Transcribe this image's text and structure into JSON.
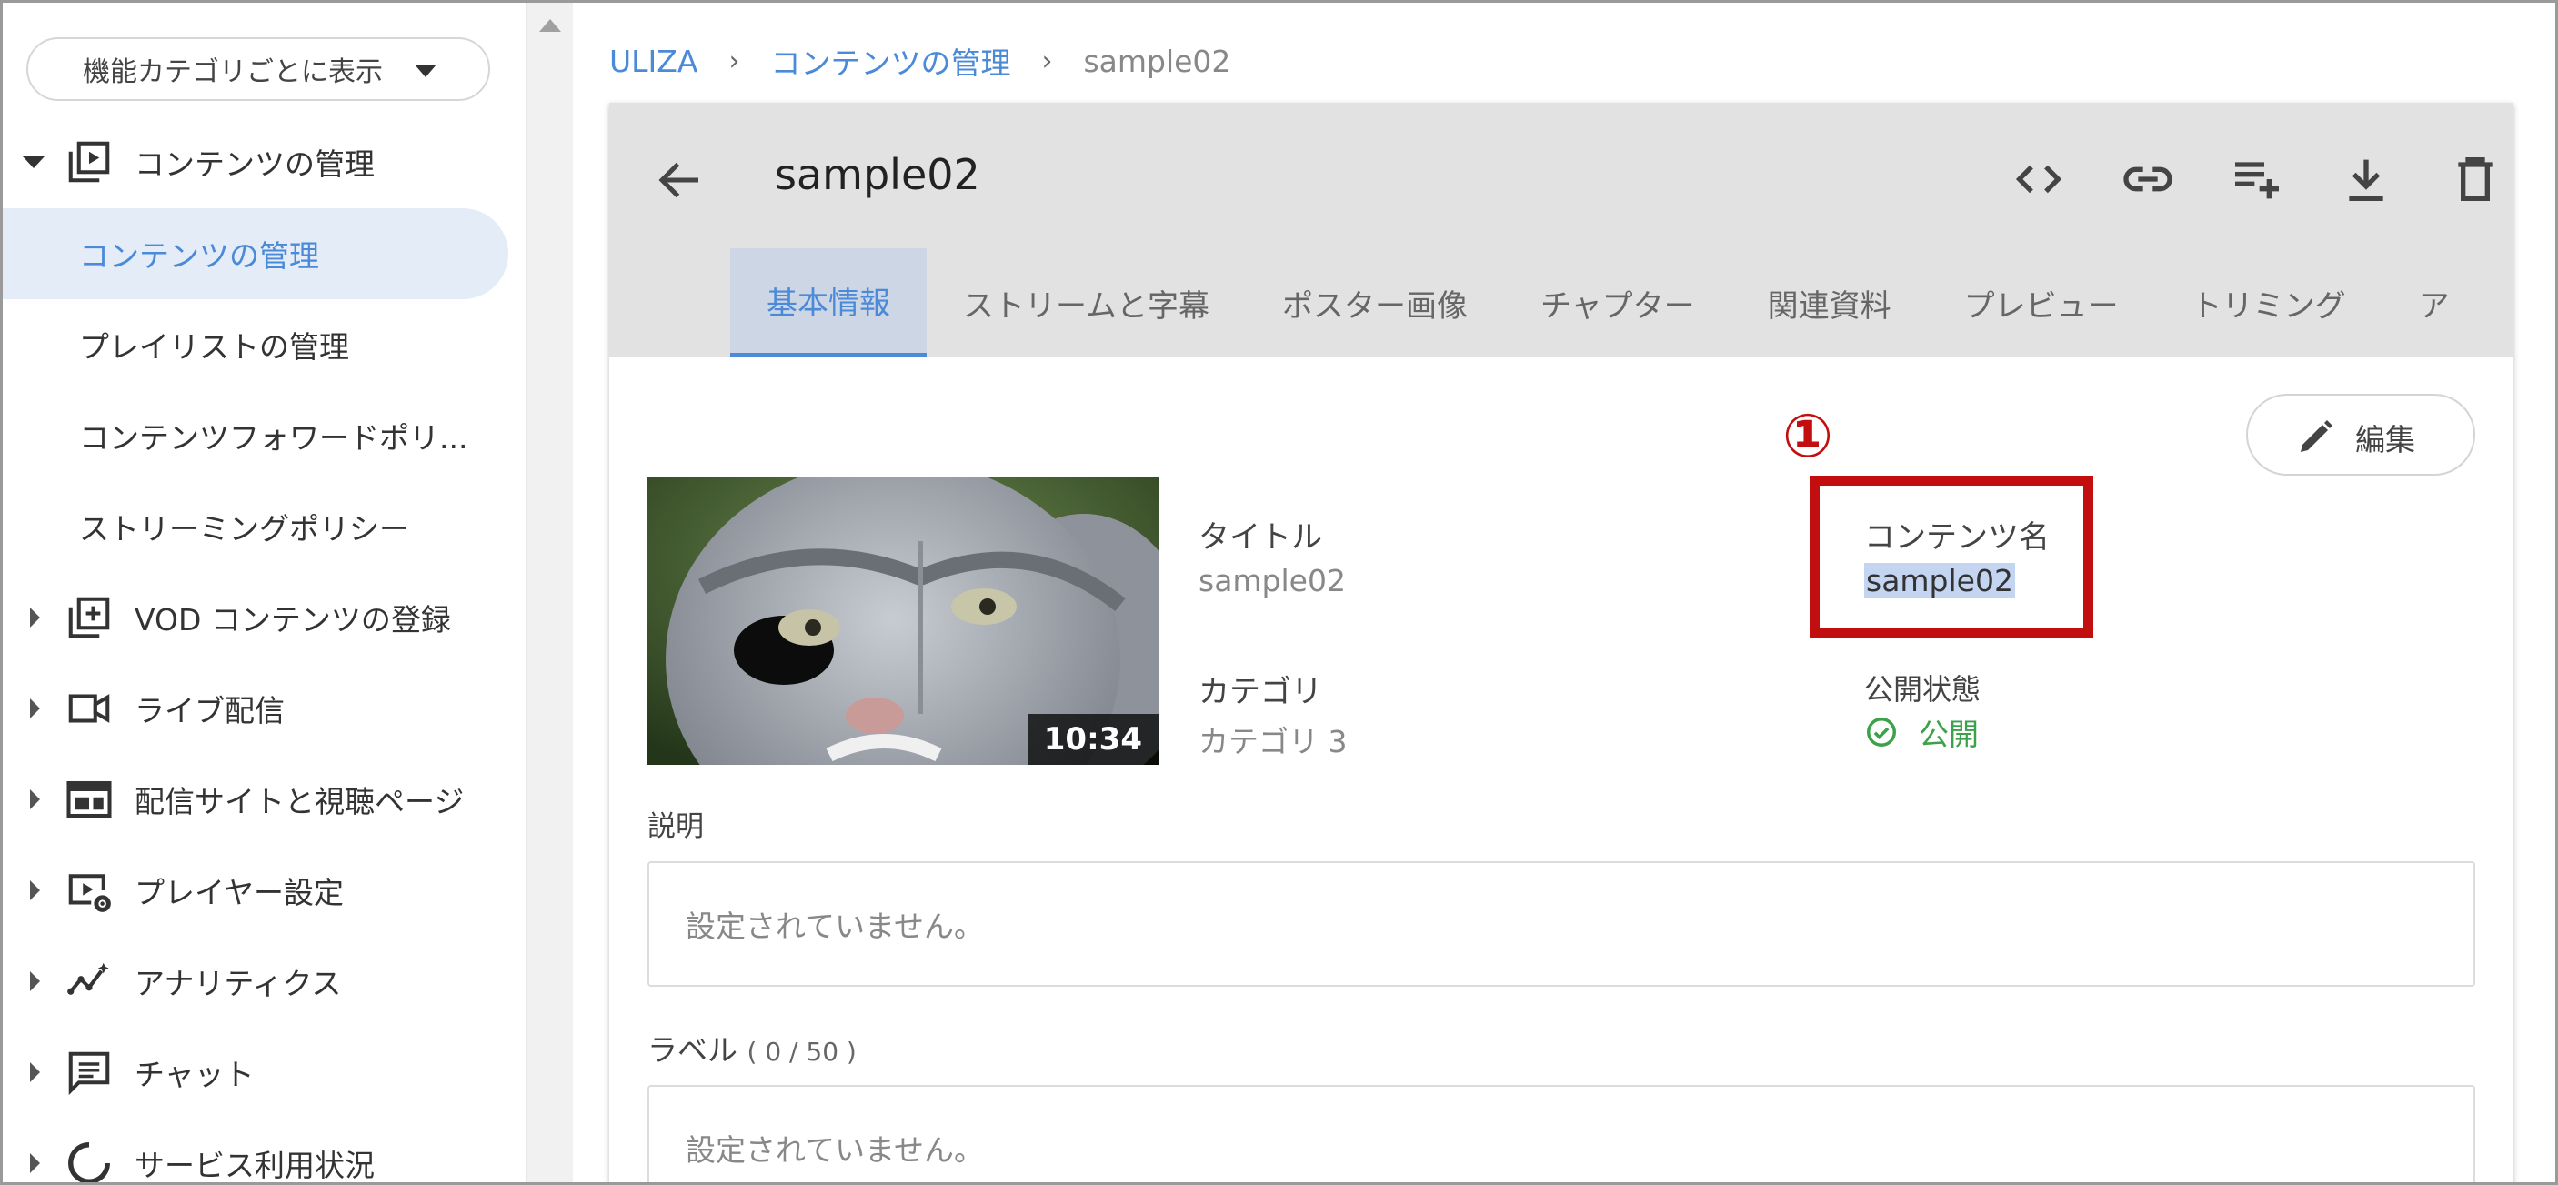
{
  "sidebar": {
    "category_select": "機能カテゴリごとに表示",
    "groups": [
      {
        "label": "コンテンツの管理",
        "icon": "video-library-icon",
        "expanded": true
      },
      {
        "label": "VOD コンテンツの登録",
        "icon": "add-box-icon"
      },
      {
        "label": "ライブ配信",
        "icon": "videocam-icon"
      },
      {
        "label": "配信サイトと視聴ページ",
        "icon": "web-layout-icon"
      },
      {
        "label": "プレイヤー設定",
        "icon": "player-settings-icon"
      },
      {
        "label": "アナリティクス",
        "icon": "analytics-icon"
      },
      {
        "label": "チャット",
        "icon": "chat-icon"
      },
      {
        "label": "サービス利用状況",
        "icon": "usage-icon"
      }
    ],
    "sub_items": [
      {
        "label": "コンテンツの管理",
        "active": true
      },
      {
        "label": "プレイリストの管理"
      },
      {
        "label": "コンテンツフォワードポリ..."
      },
      {
        "label": "ストリーミングポリシー"
      }
    ]
  },
  "breadcrumb": {
    "root": "ULIZA",
    "section": "コンテンツの管理",
    "current": "sample02"
  },
  "content": {
    "title": "sample02",
    "toolbar_icons": [
      "code-icon",
      "link-icon",
      "playlist-add-icon",
      "download-icon",
      "delete-icon"
    ],
    "tabs": [
      "基本情報",
      "ストリームと字幕",
      "ポスター画像",
      "チャプター",
      "関連資料",
      "プレビュー",
      "トリミング",
      "ア"
    ],
    "active_tab": "基本情報",
    "edit_label": "編集",
    "thumbnail_duration": "10:34",
    "fields": {
      "title_label": "タイトル",
      "title_value": "sample02",
      "name_label": "コンテンツ名",
      "name_value": "sample02",
      "category_label": "カテゴリ",
      "category_value": "カテゴリ 3",
      "status_label": "公開状態",
      "status_value": "公開"
    },
    "description_label": "説明",
    "description_value": "設定されていません。",
    "labels_label": "ラベル",
    "labels_count": "( 0 / 50 )",
    "labels_value": "設定されていません。"
  },
  "annotation": {
    "number": "1"
  },
  "colors": {
    "accent": "#4a8ad8",
    "active_bg": "#e4ecf8",
    "header_bg": "#e2e2e2",
    "success": "#3ba24a",
    "annotation": "#c20e0e"
  }
}
